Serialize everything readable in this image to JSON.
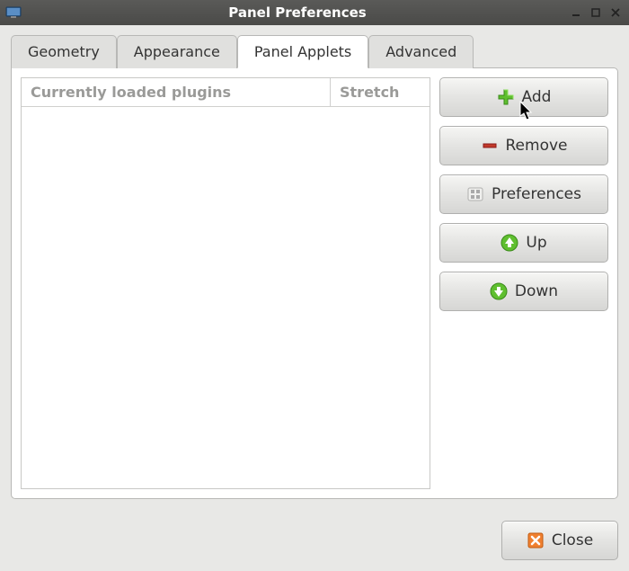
{
  "window": {
    "title": "Panel Preferences"
  },
  "tabs": [
    {
      "label": "Geometry",
      "active": false
    },
    {
      "label": "Appearance",
      "active": false
    },
    {
      "label": "Panel Applets",
      "active": true
    },
    {
      "label": "Advanced",
      "active": false
    }
  ],
  "table": {
    "columns": {
      "name": "Currently loaded plugins",
      "stretch": "Stretch"
    },
    "rows": []
  },
  "buttons": {
    "add": "Add",
    "remove": "Remove",
    "preferences": "Preferences",
    "up": "Up",
    "down": "Down"
  },
  "footer": {
    "close": "Close"
  }
}
